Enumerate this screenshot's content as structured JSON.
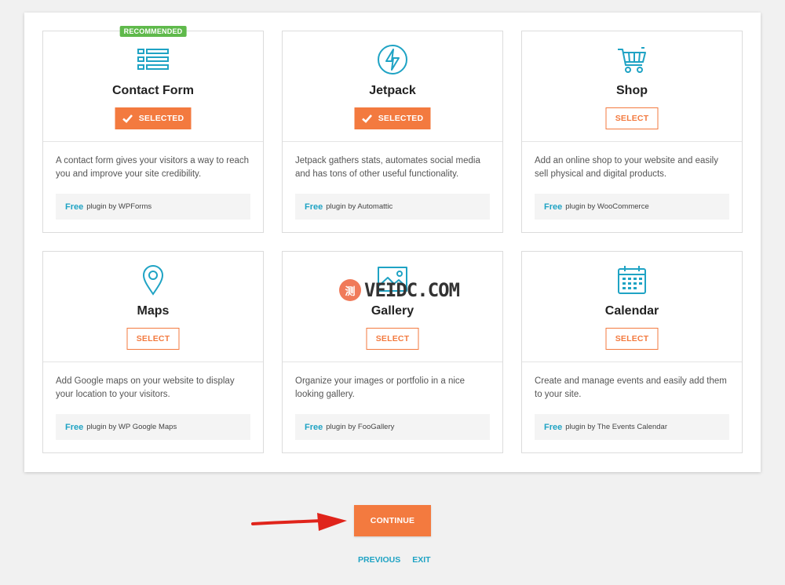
{
  "colors": {
    "accent": "#f37a3f",
    "link": "#1fa3c4",
    "badge": "#5fb94b",
    "icon": "#1fa3c4"
  },
  "cards": [
    {
      "title": "Contact Form",
      "icon": "contact-form-icon",
      "badge": "RECOMMENDED",
      "button": "SELECTED",
      "selected": true,
      "description": "A contact form gives your visitors a way to reach you and improve your site credibility.",
      "free": "Free",
      "by": "plugin by WPForms"
    },
    {
      "title": "Jetpack",
      "icon": "jetpack-bolt-icon",
      "button": "SELECTED",
      "selected": true,
      "description": "Jetpack gathers stats, automates social media and has tons of other useful functionality.",
      "free": "Free",
      "by": "plugin by Automattic"
    },
    {
      "title": "Shop",
      "icon": "shopping-cart-icon",
      "button": "SELECT",
      "selected": false,
      "description": "Add an online shop to your website and easily sell physical and digital products.",
      "free": "Free",
      "by": "plugin by WooCommerce"
    },
    {
      "title": "Maps",
      "icon": "map-pin-icon",
      "button": "SELECT",
      "selected": false,
      "description": "Add Google maps on your website to display your location to your visitors.",
      "free": "Free",
      "by": "plugin by WP Google Maps"
    },
    {
      "title": "Gallery",
      "icon": "image-gallery-icon",
      "button": "SELECT",
      "selected": false,
      "description": "Organize your images or portfolio in a nice looking gallery.",
      "free": "Free",
      "by": "plugin by FooGallery"
    },
    {
      "title": "Calendar",
      "icon": "calendar-icon",
      "button": "SELECT",
      "selected": false,
      "description": "Create and manage events and easily add them to your site.",
      "free": "Free",
      "by": "plugin by The Events Calendar"
    }
  ],
  "actions": {
    "continue": "CONTINUE",
    "previous": "PREVIOUS",
    "exit": "EXIT"
  },
  "watermark": {
    "mark": "测",
    "text": "VEIDC.COM"
  }
}
